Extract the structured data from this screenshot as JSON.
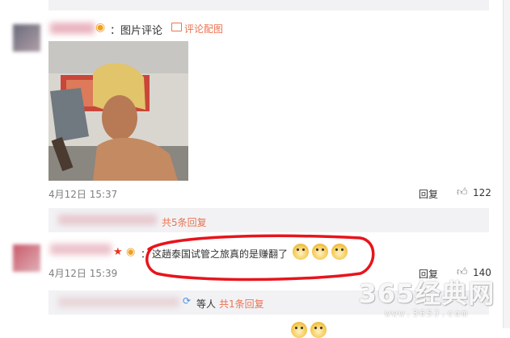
{
  "comment1": {
    "label": "：图片评论",
    "link": "评论配图",
    "time": "4月12日 15:37",
    "reply": "回复",
    "likes": "122",
    "sub_replies": "共5条回复"
  },
  "comment2": {
    "text": "这趟泰国试管之旅真的是赚翻了",
    "time": "4月12日 15:39",
    "reply": "回复",
    "likes": "140",
    "sub_prefix": "等人",
    "sub_replies": "共1条回复"
  },
  "watermark": {
    "text": "365经典网",
    "url": "www.365J.com"
  },
  "colors": {
    "link": "#eb7350",
    "highlight_circle": "#e8141c",
    "reply_bar": "#f2f2f5"
  }
}
